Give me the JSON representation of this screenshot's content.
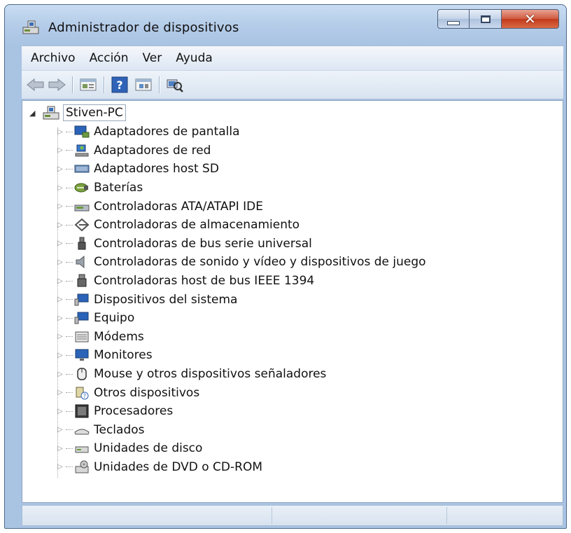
{
  "window": {
    "title": "Administrador de dispositivos"
  },
  "menubar": {
    "items": [
      "Archivo",
      "Acción",
      "Ver",
      "Ayuda"
    ]
  },
  "toolbar": {
    "buttons": [
      "back-arrow-icon",
      "forward-arrow-icon",
      "properties-icon",
      "help-icon",
      "update-driver-icon",
      "scan-hardware-icon"
    ]
  },
  "tree": {
    "root": "Stiven-PC",
    "items": [
      {
        "label": "Adaptadores de pantalla",
        "icon": "display-adapter-icon"
      },
      {
        "label": "Adaptadores de red",
        "icon": "network-adapter-icon"
      },
      {
        "label": "Adaptadores host SD",
        "icon": "sd-host-icon"
      },
      {
        "label": "Baterías",
        "icon": "battery-icon"
      },
      {
        "label": "Controladoras ATA/ATAPI IDE",
        "icon": "ide-controller-icon"
      },
      {
        "label": "Controladoras de almacenamiento",
        "icon": "storage-controller-icon"
      },
      {
        "label": "Controladoras de bus serie universal",
        "icon": "usb-icon"
      },
      {
        "label": "Controladoras de sonido y vídeo y dispositivos de juego",
        "icon": "speaker-icon"
      },
      {
        "label": "Controladoras host de bus IEEE 1394",
        "icon": "ieee1394-icon"
      },
      {
        "label": "Dispositivos del sistema",
        "icon": "system-device-icon"
      },
      {
        "label": "Equipo",
        "icon": "computer-icon"
      },
      {
        "label": "Módems",
        "icon": "modem-icon"
      },
      {
        "label": "Monitores",
        "icon": "monitor-icon"
      },
      {
        "label": "Mouse y otros dispositivos señaladores",
        "icon": "mouse-icon"
      },
      {
        "label": "Otros dispositivos",
        "icon": "unknown-device-icon"
      },
      {
        "label": "Procesadores",
        "icon": "processor-icon"
      },
      {
        "label": "Teclados",
        "icon": "keyboard-icon"
      },
      {
        "label": "Unidades de disco",
        "icon": "disk-drive-icon"
      },
      {
        "label": "Unidades de DVD o CD-ROM",
        "icon": "dvd-drive-icon"
      }
    ]
  }
}
